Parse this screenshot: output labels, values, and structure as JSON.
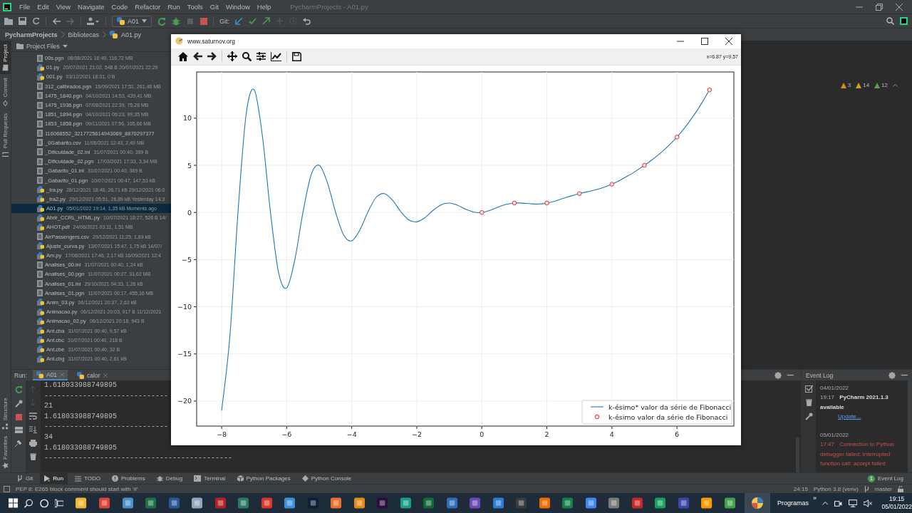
{
  "ide": {
    "title": "PycharmProjects - A01.py",
    "menu": [
      "File",
      "Edit",
      "View",
      "Navigate",
      "Code",
      "Refactor",
      "Run",
      "Tools",
      "Git",
      "Window",
      "Help"
    ],
    "run_config": "A01",
    "git_label": "Git:",
    "breadcrumb": [
      {
        "label": "PycharmProjects",
        "kind": "project"
      },
      {
        "label": "Bibliotecas",
        "kind": "folder"
      },
      {
        "label": "A01.py",
        "kind": "python"
      }
    ],
    "side_tabs_top": [
      {
        "label": "Project",
        "kind": "project",
        "selected": true
      },
      {
        "label": "Commit",
        "kind": "commit",
        "selected": false
      },
      {
        "label": "Pull Requests",
        "kind": "pull",
        "selected": false
      }
    ],
    "side_tabs_bottom": [
      {
        "label": "Structure",
        "kind": "structure",
        "selected": false
      },
      {
        "label": "Favorites",
        "kind": "favorites",
        "selected": false
      }
    ]
  },
  "project_panel": {
    "title": "Project Files",
    "files": [
      {
        "name": "00s.pgn",
        "meta": "08/08/2021 16:49, 116,72 MB",
        "kind": "file",
        "selected": false
      },
      {
        "name": "01.py",
        "meta": "20/07/2021 21:02, 548 B 20/07/2021 22:29",
        "kind": "python",
        "selected": false
      },
      {
        "name": "001.py",
        "meta": "03/12/2021 18:31, 0 B",
        "kind": "python",
        "selected": false
      },
      {
        "name": "312_calibrados.pgn",
        "meta": "16/09/2021 17:51, 261,48 MB",
        "kind": "file",
        "selected": false
      },
      {
        "name": "1475_1840.pgn",
        "meta": "04/10/2021 14:53, 439,41 MB",
        "kind": "file",
        "selected": false
      },
      {
        "name": "1475_1936.pgn",
        "meta": "07/08/2021 22:39, 75,28 MB",
        "kind": "file",
        "selected": false
      },
      {
        "name": "1851_1894.pgn",
        "meta": "04/10/2021 06:23, 99,35 MB",
        "kind": "file",
        "selected": false
      },
      {
        "name": "1853_1858.pgn",
        "meta": "09/11/2021 07:56, 165,66 MB",
        "kind": "file",
        "selected": false
      },
      {
        "name": "116068552_3217725614943069_8870297377",
        "kind": "file",
        "selected": false
      },
      {
        "name": "_0Gabarito.csv",
        "meta": "11/06/2021 12:43, 2,49 MB",
        "kind": "file",
        "selected": false
      },
      {
        "name": "_Dificuldade_02.ini",
        "meta": "31/07/2021 00:40, 389 B",
        "kind": "file",
        "selected": false
      },
      {
        "name": "_Dificuldade_02.pgn",
        "meta": "17/03/2021 17:33, 3,34 MB",
        "kind": "file",
        "selected": false
      },
      {
        "name": "_Gabarito_01.ini",
        "meta": "31/07/2021 00:40, 389 B",
        "kind": "file",
        "selected": false
      },
      {
        "name": "_Gabarito_01.pgn",
        "meta": "10/07/2021 06:47, 147,53 kB",
        "kind": "file",
        "selected": false
      },
      {
        "name": "_tra.py",
        "meta": "28/12/2021 18:46, 26,71 kB 29/12/2021 06:0",
        "kind": "python",
        "selected": false
      },
      {
        "name": "_tra2.py",
        "meta": "29/12/2021 05:51, 26,89 kB Yesterday 14:3",
        "kind": "python",
        "selected": false
      },
      {
        "name": "A01.py",
        "meta": "05/01/2022 19:14, 1,35 kB Moments ago",
        "kind": "python",
        "selected": true
      },
      {
        "name": "Abrir_CCRL_HTML.py",
        "meta": "10/07/2021 18:27, 526 B 14/",
        "kind": "python",
        "selected": false
      },
      {
        "name": "AHOT.pdf",
        "meta": "24/06/2021 03:11, 1,51 MB",
        "kind": "python",
        "selected": false
      },
      {
        "name": "AirPassengers.csv",
        "meta": "29/12/2021 11:25, 1,89 kB",
        "kind": "file",
        "selected": false
      },
      {
        "name": "Ajuste_curva.py",
        "meta": "13/07/2021 15:47, 1,75 kB 14/07/",
        "kind": "python",
        "selected": false
      },
      {
        "name": "Am.py",
        "meta": "17/08/2021 17:46, 2,17 kB 16/09/2021 12:4",
        "kind": "python",
        "selected": false
      },
      {
        "name": "Analises_00.ini",
        "meta": "31/07/2021 00:40, 1,24 kB",
        "kind": "file",
        "selected": false
      },
      {
        "name": "Analises_00.pgn",
        "meta": "11/07/2021 00:27, 31,62 MB",
        "kind": "file",
        "selected": false
      },
      {
        "name": "Analises_01.ini",
        "meta": "29/10/2021 04:33, 1,26 kB",
        "kind": "file",
        "selected": false
      },
      {
        "name": "Analises_01.pgn",
        "meta": "11/07/2021 00:17, 455,16 MB",
        "kind": "file",
        "selected": false
      },
      {
        "name": "Anim_03.py",
        "meta": "06/12/2021 20:37, 2,63 kB",
        "kind": "python",
        "selected": false
      },
      {
        "name": "Animacao.py",
        "meta": "06/12/2021 20:03, 917 B 11/12/2021",
        "kind": "python",
        "selected": false
      },
      {
        "name": "Animacao_02.py",
        "meta": "06/12/2021 20:18, 943 B",
        "kind": "python",
        "selected": false
      },
      {
        "name": "Ant.cba",
        "meta": "31/07/2021 00:40, 9,57 kB",
        "kind": "python",
        "selected": false
      },
      {
        "name": "Ant.cbc",
        "meta": "31/07/2021 00:40, 218 B",
        "kind": "python",
        "selected": false
      },
      {
        "name": "Ant.cbe",
        "meta": "31/07/2021 00:40, 32 B",
        "kind": "python",
        "selected": false
      },
      {
        "name": "Ant.cbg",
        "meta": "31/07/2021 00:40, 2,61 kB",
        "kind": "python",
        "selected": false
      }
    ]
  },
  "inspections": [
    {
      "kind": "warning",
      "count": "3"
    },
    {
      "kind": "weak",
      "count": "14"
    },
    {
      "kind": "typo",
      "count": "12"
    }
  ],
  "run_panel": {
    "label": "Run:",
    "tabs": [
      {
        "label": "A01",
        "selected": true
      },
      {
        "label": "calor",
        "selected": false
      }
    ],
    "output": [
      "1.618033988749895",
      "-----------------------------",
      "21",
      "1.618033988749895",
      "-----------------------------",
      "34",
      "1.618033988749895",
      "--------------------------------------------"
    ]
  },
  "event_log": {
    "title": "Event Log",
    "entries": [
      {
        "date": "04/01/2022",
        "time": "19:17",
        "kind": "info",
        "text": "PyCharm 2021.1.3 available",
        "link": "Update..."
      },
      {
        "date": "05/01/2022",
        "time": "17:47",
        "kind": "error",
        "text": "Connection to Python debugger failed: Interrupted function call: accept failed"
      }
    ]
  },
  "tool_windows": [
    {
      "label": "Git",
      "kind": "git",
      "selected": false
    },
    {
      "label": "Run",
      "kind": "run",
      "selected": true
    },
    {
      "label": "TODO",
      "kind": "todo",
      "selected": false
    },
    {
      "label": "Problems",
      "kind": "problems",
      "selected": false
    },
    {
      "label": "Debug",
      "kind": "debug",
      "selected": false
    },
    {
      "label": "Terminal",
      "kind": "terminal",
      "selected": false
    },
    {
      "label": "Python Packages",
      "kind": "packages",
      "selected": false
    },
    {
      "label": "Python Console",
      "kind": "console",
      "selected": false
    }
  ],
  "event_log_button": {
    "badge": "1",
    "label": "Event Log"
  },
  "status_bar": {
    "message": "PEP 8: E265 block comment should start with '#'",
    "position": "24:15",
    "interpreter": "Python 3.8 (venv)",
    "branch": "master"
  },
  "figure_window": {
    "title": "www.saturnov.org",
    "coords": "x=6.87 y=9.57",
    "chart_data": {
      "type": "line",
      "grid": true,
      "legend": true,
      "xlim": [
        -8.77,
        7.75
      ],
      "ylim": [
        -22.65,
        14.9
      ],
      "xticks": [
        {
          "value": -8,
          "label": "−8"
        },
        {
          "value": -6,
          "label": "−6"
        },
        {
          "value": -4,
          "label": "−4"
        },
        {
          "value": -2,
          "label": "−2"
        },
        0,
        2,
        4,
        6
      ],
      "yticks": [
        {
          "value": -20,
          "label": "−20"
        },
        {
          "value": -15,
          "label": "−15"
        },
        {
          "value": -10,
          "label": "−10"
        },
        {
          "value": -5,
          "label": "−5"
        },
        0,
        5,
        10
      ],
      "x": [
        -8,
        -7.75,
        -7.5,
        -7.25,
        -7,
        -6.75,
        -6.5,
        -6.25,
        -6,
        -5.75,
        -5.5,
        -5.25,
        -5,
        -4.75,
        -4.5,
        -4.25,
        -4,
        -3.75,
        -3.5,
        -3.25,
        -3,
        -2.75,
        -2.5,
        -2.25,
        -2,
        -1.75,
        -1.5,
        -1.25,
        -1,
        -0.75,
        -0.5,
        -0.25,
        0,
        0.25,
        0.5,
        0.75,
        1,
        1.25,
        1.5,
        1.75,
        2,
        2.25,
        2.5,
        2.75,
        3,
        3.25,
        3.5,
        3.75,
        4,
        4.25,
        4.5,
        4.75,
        5,
        5.25,
        5.5,
        5.75,
        6,
        6.25,
        6.5,
        6.75,
        7
      ],
      "series": [
        {
          "name": "k-ésimo* valor da série de Fibonacci",
          "type": "line",
          "color": "#1f77b4",
          "values": [
            -21.0,
            -13.16,
            0.01,
            10.37,
            13.0,
            8.16,
            0.02,
            -6.38,
            -8.0,
            -5.0,
            0.03,
            3.99,
            5.0,
            3.16,
            0.05,
            -2.39,
            -3.0,
            -1.85,
            0.08,
            1.6,
            2.0,
            1.31,
            0.13,
            -0.78,
            -1.0,
            -0.54,
            0.22,
            0.82,
            1.0,
            0.77,
            0.35,
            0.04,
            0,
            0.22,
            0.57,
            0.86,
            1.0,
            0.99,
            0.92,
            0.9,
            1.0,
            1.21,
            1.49,
            1.76,
            2.0,
            2.2,
            2.41,
            2.67,
            3.0,
            3.42,
            3.9,
            4.43,
            5.0,
            5.62,
            6.31,
            7.1,
            8.0,
            9.04,
            10.21,
            11.53,
            13.0
          ]
        },
        {
          "name": "k-ésimo valor da série de Fibonacci",
          "type": "scatter",
          "color": "#d62728",
          "x": [
            0,
            1,
            2,
            3,
            4,
            5,
            6,
            7
          ],
          "values": [
            0,
            1,
            1,
            2,
            3,
            5,
            8,
            13
          ]
        }
      ]
    }
  },
  "taskbar": {
    "search_label": "Programas",
    "overflow": "»",
    "time": "19:15",
    "date": "05/01/2022"
  }
}
